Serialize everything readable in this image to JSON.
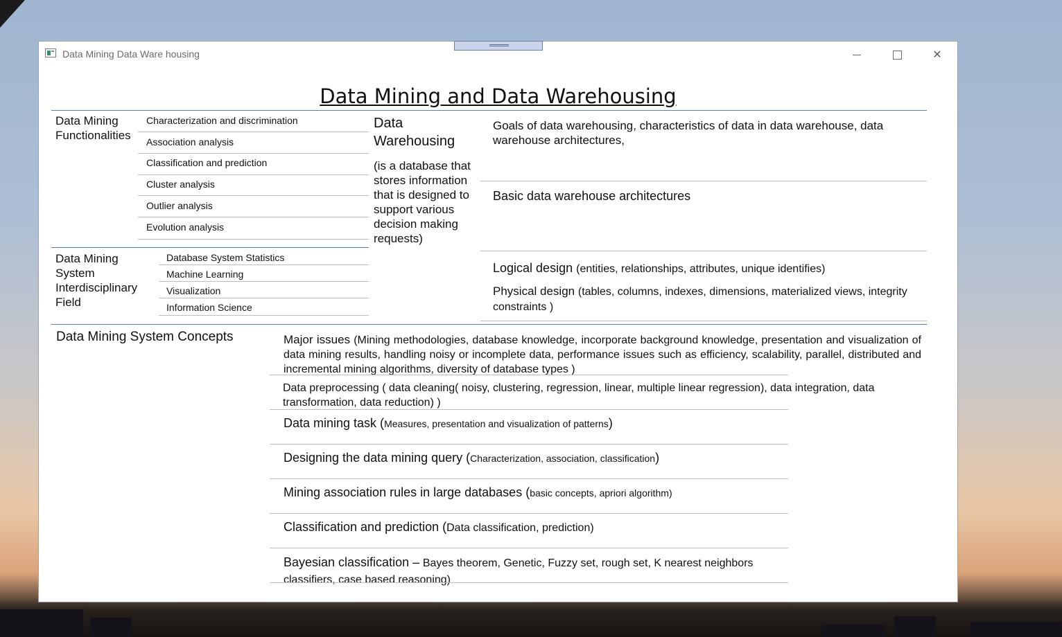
{
  "window": {
    "title": "Data Mining Data Ware housing",
    "controls": {
      "minimize": "minimize",
      "maximize": "maximize",
      "close": "close"
    }
  },
  "slide": {
    "title": "Data Mining and Data Warehousing",
    "functionalities": {
      "heading": "Data Mining Functionalities",
      "items": [
        "Characterization and discrimination",
        "Association analysis",
        "Classification and prediction",
        "Cluster analysis",
        "Outlier analysis",
        "Evolution analysis"
      ]
    },
    "interdisciplinary": {
      "heading": "Data Mining System Interdisciplinary Field",
      "items": [
        "Database System Statistics",
        "Machine Learning",
        "Visualization",
        "Information Science"
      ]
    },
    "warehousing": {
      "heading": "Data Warehousing",
      "definition": "(is a database that stores information that is designed to support various decision making requests)",
      "goals": "Goals of data warehousing, characteristics of data in data warehouse, data warehouse architectures,",
      "basic": "Basic data warehouse architectures",
      "logical_main": "Logical design",
      "logical_detail": "(entities, relationships, attributes, unique identifies)",
      "physical_main": "Physical design",
      "physical_detail": "(tables, columns, indexes, dimensions, materialized views, integrity constraints )"
    },
    "concepts": {
      "heading": "Data Mining System Concepts",
      "major_main": "Major issues",
      "major_detail": "(Mining methodologies, database knowledge, incorporate background knowledge, presentation and visualization of data mining results, handling noisy or incomplete data, performance issues such as efficiency, scalability, parallel, distributed and incremental mining algorithms, diversity of database types )",
      "preprocessing": "Data preprocessing ( data cleaning( noisy, clustering, regression, linear, multiple linear regression), data integration, data transformation, data reduction) )",
      "task_main": "Data mining task (",
      "task_detail": "Measures, presentation and visualization of patterns",
      "query_main": "Designing the data mining query (",
      "query_detail": "Characterization, association, classification",
      "assoc_main": "Mining association rules in large databases (",
      "assoc_detail": "basic concepts, apriori algorithm)",
      "classif_main": "Classification and prediction (",
      "classif_detail": "Data classification, prediction)",
      "bayes_main": "Bayesian classification –",
      "bayes_detail": "Bayes theorem, Genetic, Fuzzy set, rough set, K nearest neighbors classifiers, case based reasoning)",
      "close_paren": ")"
    }
  }
}
